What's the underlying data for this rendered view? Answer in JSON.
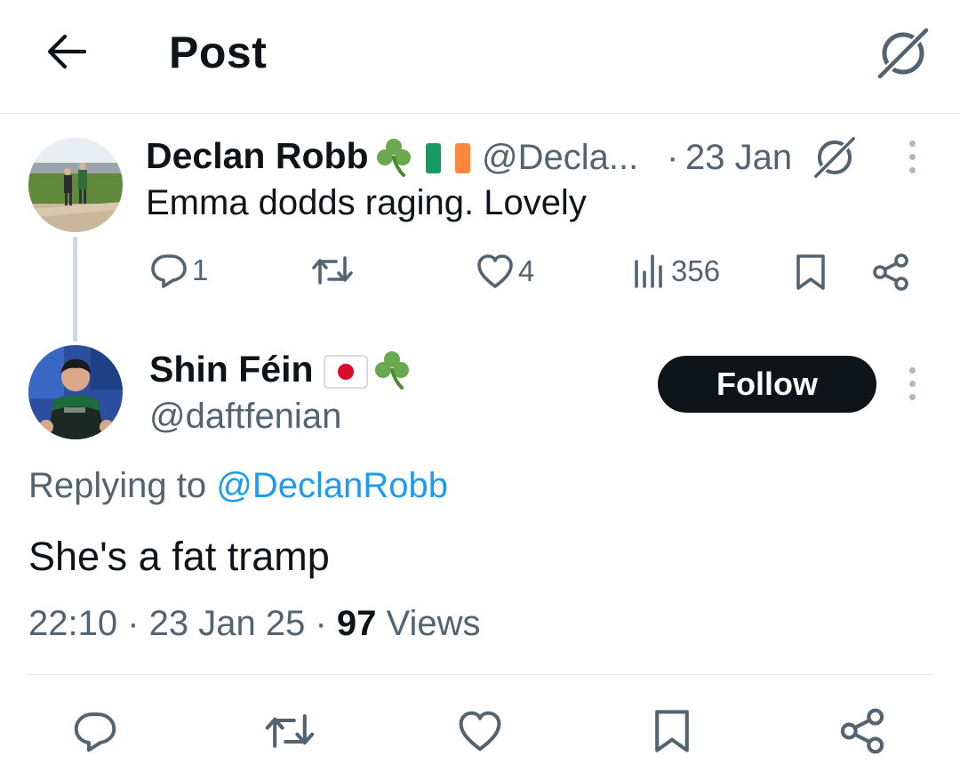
{
  "header": {
    "title": "Post",
    "back_icon": "arrow-left-icon",
    "grok_icon": "grok-icon"
  },
  "parent_post": {
    "author_name": "Declan Robb",
    "emojis": [
      "shamrock",
      "ireland-flag"
    ],
    "handle": "@Decla...",
    "separator": "·",
    "date": "23 Jan",
    "text": "Emma dodds raging. Lovely",
    "stats": {
      "replies": "1",
      "reposts": "",
      "likes": "4",
      "views": "356"
    }
  },
  "reply_post": {
    "author_name": "Shin Féin",
    "emojis": [
      "japan-flag",
      "shamrock"
    ],
    "handle": "@daftfenian",
    "follow_label": "Follow",
    "replying_prefix": "Replying to ",
    "replying_to": "@DeclanRobb",
    "text": "She's a fat tramp",
    "time": "22:10",
    "sep1": " · ",
    "date": "23 Jan 25",
    "sep2": " · ",
    "views_count": "97",
    "views_label": " Views"
  },
  "colors": {
    "text": "#0f1419",
    "secondary": "#536471",
    "link": "#1d9bf0",
    "divider": "#e1e5e8",
    "follow_bg": "#0f1419"
  }
}
